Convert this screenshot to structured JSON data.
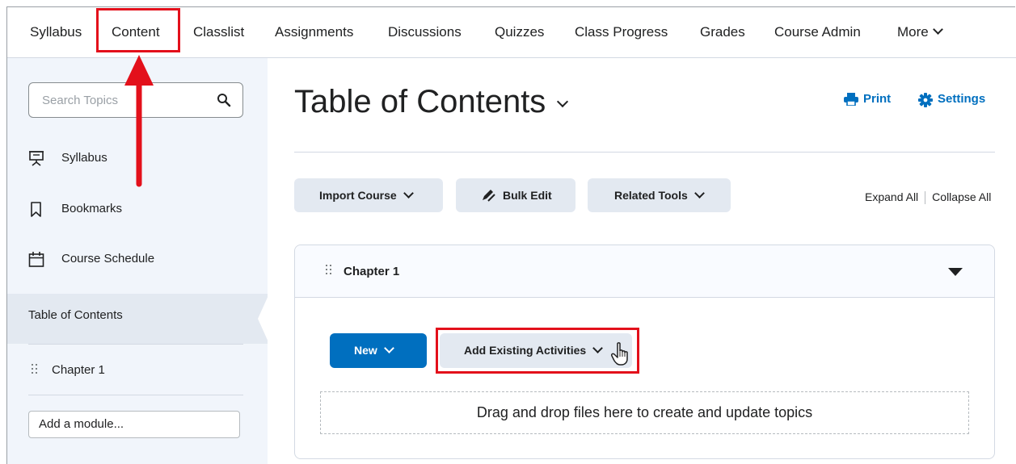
{
  "nav": {
    "items": [
      "Syllabus",
      "Content",
      "Classlist",
      "Assignments",
      "Discussions",
      "Quizzes",
      "Class Progress",
      "Grades",
      "Course Admin"
    ],
    "more_label": "More"
  },
  "sidebar": {
    "search_placeholder": "Search Topics",
    "items": [
      "Syllabus",
      "Bookmarks",
      "Course Schedule"
    ],
    "toc_label": "Table of Contents",
    "chapter_label": "Chapter 1",
    "add_module_label": "Add a module..."
  },
  "main": {
    "title": "Table of Contents",
    "print_label": "Print",
    "settings_label": "Settings",
    "import_course_label": "Import Course",
    "bulk_edit_label": "Bulk Edit",
    "related_tools_label": "Related Tools",
    "expand_all_label": "Expand All",
    "collapse_all_label": "Collapse All"
  },
  "chapter_panel": {
    "title": "Chapter 1",
    "new_label": "New",
    "add_existing_label": "Add Existing Activities",
    "dropzone_text": "Drag and drop files here to create and update topics"
  },
  "colors": {
    "accent": "#006fbf",
    "highlight_red": "#e3101b",
    "button_bg": "#e3e9f1",
    "sidebar_bg": "#f1f5fb"
  }
}
